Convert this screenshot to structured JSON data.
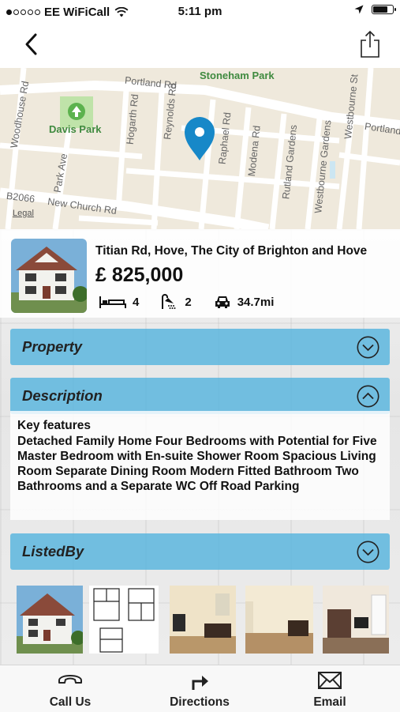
{
  "status_bar": {
    "carrier": "EE WiFiCall",
    "time": "5:11 pm",
    "signal_bars": 1,
    "battery_level": 0.8
  },
  "nav": {
    "back_icon": "chevron-left-icon",
    "share_icon": "share-icon"
  },
  "map": {
    "streets": [
      "Portland Rd",
      "Stoneham Park",
      "Woodhouse Rd",
      "Davis Park",
      "Hogarth Rd",
      "Reynolds Rd",
      "Raphael Rd",
      "Modena Rd",
      "Rutland Gardens",
      "Westbourne Gardens",
      "Westbourne St",
      "Park Ave",
      "B2066",
      "New Church Rd",
      "Portland"
    ],
    "legal": "Legal",
    "park_color": "#3f8a3f"
  },
  "listing": {
    "address": "Titian Rd, Hove, The City of Brighton and Hove",
    "price": "£ 825,000",
    "bedrooms": "4",
    "bathrooms": "2",
    "distance": "34.7mi"
  },
  "sections": {
    "property": "Property",
    "description": "Description",
    "listed_by": "ListedBy"
  },
  "description": {
    "heading": "Key features",
    "text": "Detached Family Home Four Bedrooms with Potential for Five Master Bedroom with En-suite Shower Room Spacious Living Room Separate Dining Room Modern Fitted Bathroom Two Bathrooms and a Separate WC Off Road Parking"
  },
  "accent_color": "#5cb6de",
  "tabs": {
    "call": "Call Us",
    "directions": "Directions",
    "email": "Email"
  }
}
